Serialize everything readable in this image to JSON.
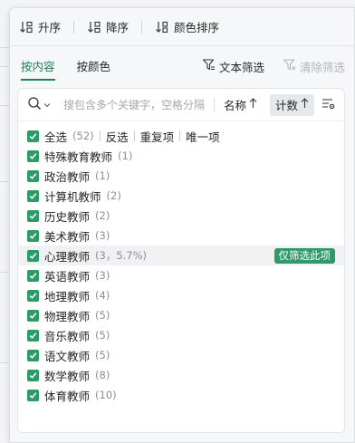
{
  "sort_bar": {
    "ascending_label": "升序",
    "descending_label": "降序",
    "color_sort_label": "颜色排序"
  },
  "tabs": {
    "by_content": "按内容",
    "by_color": "按颜色"
  },
  "filter_actions": {
    "text_filter": "文本筛选",
    "clear_filter": "清除筛选"
  },
  "search": {
    "placeholder": "搜包含多个关键字，空格分隔",
    "value": ""
  },
  "sort_keys": {
    "name_label": "名称",
    "count_label": "计数"
  },
  "select_all": {
    "label": "全选",
    "count": "(52)",
    "invert": "反选",
    "duplicates": "重复项",
    "unique": "唯一项"
  },
  "items": [
    {
      "label": "特殊教育教师",
      "count": "(1)"
    },
    {
      "label": "政治教师",
      "count": "(1)"
    },
    {
      "label": "计算机教师",
      "count": "(2)"
    },
    {
      "label": "历史教师",
      "count": "(2)"
    },
    {
      "label": "美术教师",
      "count": "(3)"
    },
    {
      "label": "心理教师",
      "count": "(3，5.7%)"
    },
    {
      "label": "英语教师",
      "count": "(3)"
    },
    {
      "label": "地理教师",
      "count": "(4)"
    },
    {
      "label": "物理教师",
      "count": "(5)"
    },
    {
      "label": "音乐教师",
      "count": "(5)"
    },
    {
      "label": "语文教师",
      "count": "(5)"
    },
    {
      "label": "数学教师",
      "count": "(8)"
    },
    {
      "label": "体育教师",
      "count": "(10)"
    }
  ],
  "only_filter_button": "仅筛选此项",
  "colors": {
    "accent": "#2e9a68",
    "tab_active": "#1e7e54"
  }
}
